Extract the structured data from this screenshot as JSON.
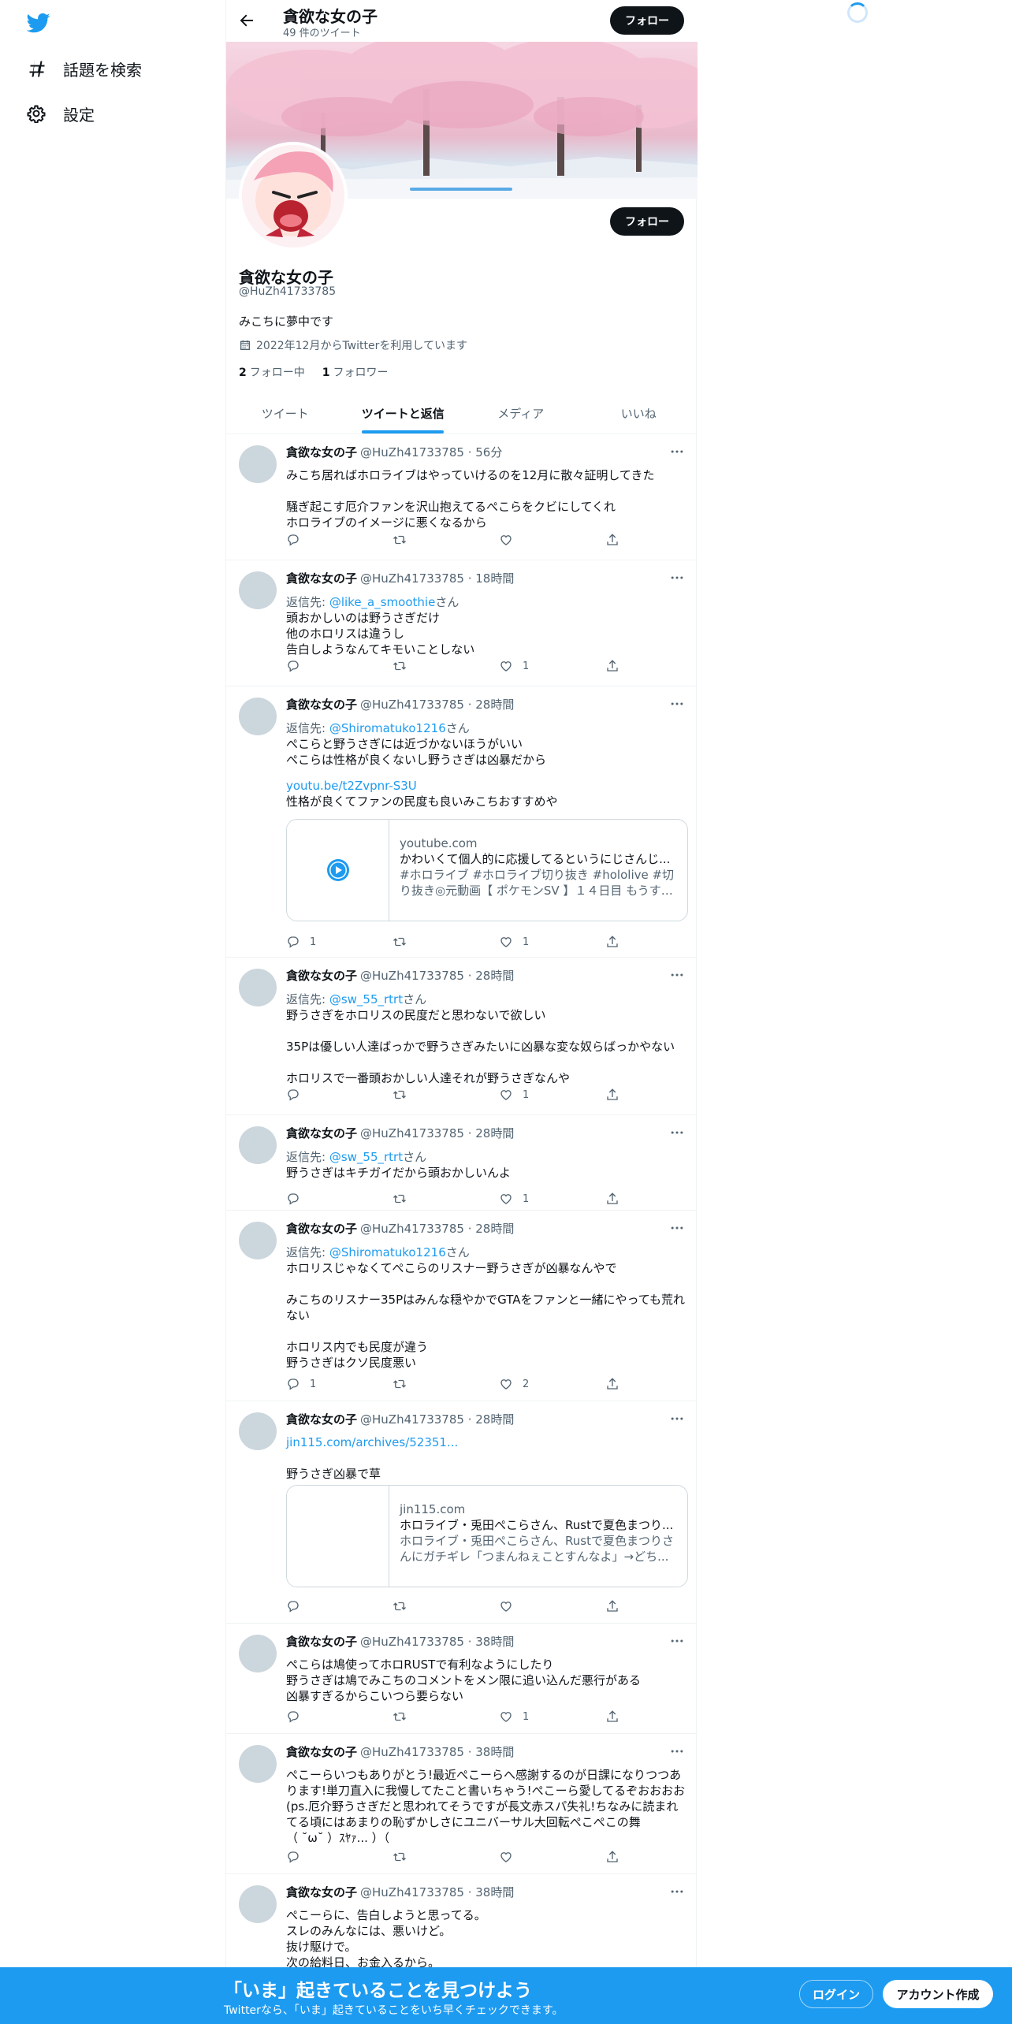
{
  "nav": {
    "items": [
      {
        "label": "話題を検索",
        "icon": "hashtag-icon"
      },
      {
        "label": "設定",
        "icon": "gear-icon"
      }
    ]
  },
  "header": {
    "title": "貪欲な女の子",
    "subtitle": "49 件のツイート",
    "follow_label": "フォロー"
  },
  "profile": {
    "name": "貪欲な女の子",
    "handle": "@HuZh41733785",
    "bio": "みこちに夢中です",
    "joined": "2022年12月からTwitterを利用しています",
    "following_count": "2",
    "following_label": "フォロー中",
    "followers_count": "1",
    "followers_label": "フォロワー",
    "follow_label": "フォロー"
  },
  "tabs": [
    "ツイート",
    "ツイートと返信",
    "メディア",
    "いいね"
  ],
  "tweets": [
    {
      "name": "貪欲な女の子",
      "meta": "@HuZh41733785 · 56分",
      "body": "みこち居ればホロライブはやっていけるのを12月に散々証明してきた\n\n騒ぎ起こす厄介ファンを沢山抱えてるぺこらをクビにしてくれ\nホロライブのイメージに悪くなるから",
      "replies": "",
      "retweets": "",
      "likes": ""
    },
    {
      "name": "貪欲な女の子",
      "meta": "@HuZh41733785 · 18時間",
      "reply_prefix": "返信先: ",
      "reply_to": "@like_a_smoothie",
      "reply_suffix": "さん",
      "body": "頭おかしいのは野うさぎだけ\n他のホロリスは違うし\n告白しようなんてキモいことしない",
      "replies": "",
      "retweets": "",
      "likes": "1"
    },
    {
      "name": "貪欲な女の子",
      "meta": "@HuZh41733785 · 28時間",
      "reply_prefix": "返信先: ",
      "reply_to": "@Shiromatuko1216",
      "reply_suffix": "さん",
      "body": "ぺこらと野うさぎには近づかないほうがいい\nぺこらは性格が良くないし野うさぎは凶暴だから",
      "link": "youtu.be/t2Zvpnr-S3U",
      "body2": "性格が良くてファンの民度も良いみこちおすすめや",
      "card": {
        "domain": "youtube.com",
        "title": "かわいくて個人的に応援してるというにじさんじ...",
        "desc": "#ホロライブ #ホロライブ切り抜き #hololive #切り抜き◎元動画【 ポケモンSV 】１４日目 もうすぐ..."
      },
      "replies": "1",
      "retweets": "",
      "likes": "1"
    },
    {
      "name": "貪欲な女の子",
      "meta": "@HuZh41733785 · 28時間",
      "reply_prefix": "返信先: ",
      "reply_to": "@sw_55_rtrt",
      "reply_suffix": "さん",
      "body": "野うさぎをホロリスの民度だと思わないで欲しい\n\n35Pは優しい人達ばっかで野うさぎみたいに凶暴な変な奴らばっかやない\n\nホロリスで一番頭おかしい人達それが野うさぎなんや",
      "replies": "",
      "retweets": "",
      "likes": "1"
    },
    {
      "name": "貪欲な女の子",
      "meta": "@HuZh41733785 · 28時間",
      "reply_prefix": "返信先: ",
      "reply_to": "@sw_55_rtrt",
      "reply_suffix": "さん",
      "body": "野うさぎはキチガイだから頭おかしいんよ",
      "replies": "",
      "retweets": "",
      "likes": "1"
    },
    {
      "name": "貪欲な女の子",
      "meta": "@HuZh41733785 · 28時間",
      "reply_prefix": "返信先: ",
      "reply_to": "@Shiromatuko1216",
      "reply_suffix": "さん",
      "body": "ホロリスじゃなくてぺこらのリスナー野うさぎが凶暴なんやで\n\nみこちのリスナー35Pはみんな穏やかでGTAをファンと一緒にやっても荒れない\n\nホロリス内でも民度が違う\n野うさぎはクソ民度悪い",
      "replies": "1",
      "retweets": "",
      "likes": "2"
    },
    {
      "name": "貪欲な女の子",
      "meta": "@HuZh41733785 · 28時間",
      "link": "jin115.com/archives/52351...",
      "body2": "野うさぎ凶暴で草",
      "card": {
        "domain": "jin115.com",
        "title": "ホロライブ・兎田ぺこらさん、Rustで夏色まつり...",
        "desc": "ホロライブ・兎田ぺこらさん、Rustで夏色まつりさんにガチギレ「つまんねぇことすんなよ」→どち..."
      },
      "replies": "",
      "retweets": "",
      "likes": ""
    },
    {
      "name": "貪欲な女の子",
      "meta": "@HuZh41733785 · 38時間",
      "body": "ぺこらは鳩使ってホロRUSTで有利なようにしたり\n野うさぎは鳩でみこちのコメントをメン限に追い込んだ悪行がある\n凶暴すぎるからこいつら要らない",
      "replies": "",
      "retweets": "",
      "likes": "1"
    },
    {
      "name": "貪欲な女の子",
      "meta": "@HuZh41733785 · 38時間",
      "body": "ぺこーらいつもありがとう!最近ぺこーらへ感謝するのが日課になりつつあります!単刀直入に我慢してたこと書いちゃう!ぺこーら愛してるぞおおおお(ps.厄介野うさぎだと思われてそうですが長文赤スパ失礼!ちなみに読まれてる頃にはあまりの恥ずかしさにユニバーサル大回転ぺこぺこの舞\n（ ˘ω˘ ）ｽﾔｧ... ）（",
      "replies": "",
      "retweets": "",
      "likes": ""
    },
    {
      "name": "貪欲な女の子",
      "meta": "@HuZh41733785 · 38時間",
      "body": "ぺこーらに、告白しようと思ってる。\nスレのみんなには、悪いけど。\n抜け駆けで。\n次の給料日、お金入るから。",
      "replies": "",
      "retweets": "",
      "likes": ""
    }
  ],
  "bottom_bar": {
    "title": "「いま」起きていることを見つけよう",
    "subtitle": "Twitterなら、「いま」起きていることをいち早くチェックできます。",
    "login_label": "ログイン",
    "signup_label": "アカウント作成"
  },
  "colors": {
    "accent": "#1d9bf0",
    "text": "#0f1419",
    "muted": "#536471",
    "border": "#eff3f4"
  }
}
